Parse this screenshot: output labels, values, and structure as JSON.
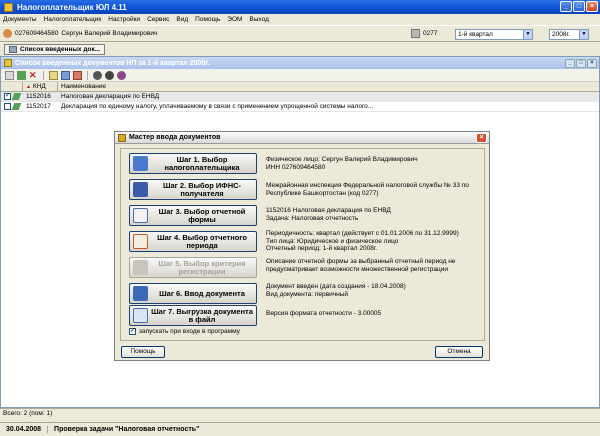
{
  "window": {
    "title": "Налогоплательщик ЮЛ 4.11",
    "controls": {
      "minimize": "_",
      "maximize": "□",
      "close": "×"
    }
  },
  "menu": [
    "Документы",
    "Налогоплательщик",
    "Настройки",
    "Сервис",
    "Вид",
    "Помощь",
    "ЭОМ",
    "Выход"
  ],
  "userbar": {
    "inn": "027609464580",
    "name": "Сергун Валерий Владимирович",
    "office_code": "0277",
    "period": "1-й квартал",
    "year": "2008г."
  },
  "tab": {
    "label": "Список введенных док..."
  },
  "docwin": {
    "title": "Список введенных документов НП за 1-й квартал 2008г.",
    "columns": {
      "knd": "КНД",
      "name": "Наименование"
    },
    "rows": [
      {
        "checked": true,
        "knd": "1152016",
        "name": "Налоговая декларация по ЕНВД"
      },
      {
        "checked": false,
        "knd": "1152017",
        "name": "Декларация по единому налогу, уплачиваемому в связи с применением упрощенной системы налого..."
      }
    ]
  },
  "status": {
    "total": "Всего: 2 (пом: 1)"
  },
  "taskbar": {
    "date": "30.04.2008",
    "task": "Проверка задачи \"Налоговая отчетность\""
  },
  "wizard": {
    "title": "Мастер ввода документов",
    "close": "×",
    "steps": [
      {
        "label": "Шаг 1. Выбор налогоплательщика",
        "enabled": true,
        "info": [
          "Физическое лицо: Сергун Валерий Владимирович",
          "ИНН 027609464580"
        ]
      },
      {
        "label": "Шаг 2. Выбор ИФНС-получателя",
        "enabled": true,
        "info": [
          "Межрайонная инспекция Федеральной налоговой службы № 33 по",
          "Республике Башкортостан (код 0277)"
        ]
      },
      {
        "label": "Шаг 3. Выбор отчетной формы",
        "enabled": true,
        "info": [
          "1152016 Налоговая декларация по ЕНВД",
          "Задача: Налоговая отчетность"
        ]
      },
      {
        "label": "Шаг 4. Выбор отчетного периода",
        "enabled": true,
        "info": [
          "Периодичность: квартал (действует с 01.01.2006 по 31.12.9999)",
          "Тип лица: Юридическое и физическое лицо",
          "Отчетный период: 1-й квартал 2008г."
        ]
      },
      {
        "label": "Шаг 5. Выбор критерия регистрации",
        "enabled": false,
        "info": [
          "Описание отчетной формы за выбранный отчетный период не",
          "предусматривает возможности множественной регистрации"
        ]
      },
      {
        "label": "Шаг 6. Ввод документа",
        "enabled": true,
        "info": [
          "Документ введен (дата создания - 18.04.2008)",
          "Вид документа: первичный"
        ]
      },
      {
        "label": "Шаг 7. Выгрузка документа в файл",
        "enabled": true,
        "info": [
          "Версия формата отчетности - 3.00005"
        ]
      }
    ],
    "autostart_label": "запускать при входе в программу",
    "autostart_checked": true,
    "help_button": "Помощь",
    "cancel_button": "Отмена"
  }
}
